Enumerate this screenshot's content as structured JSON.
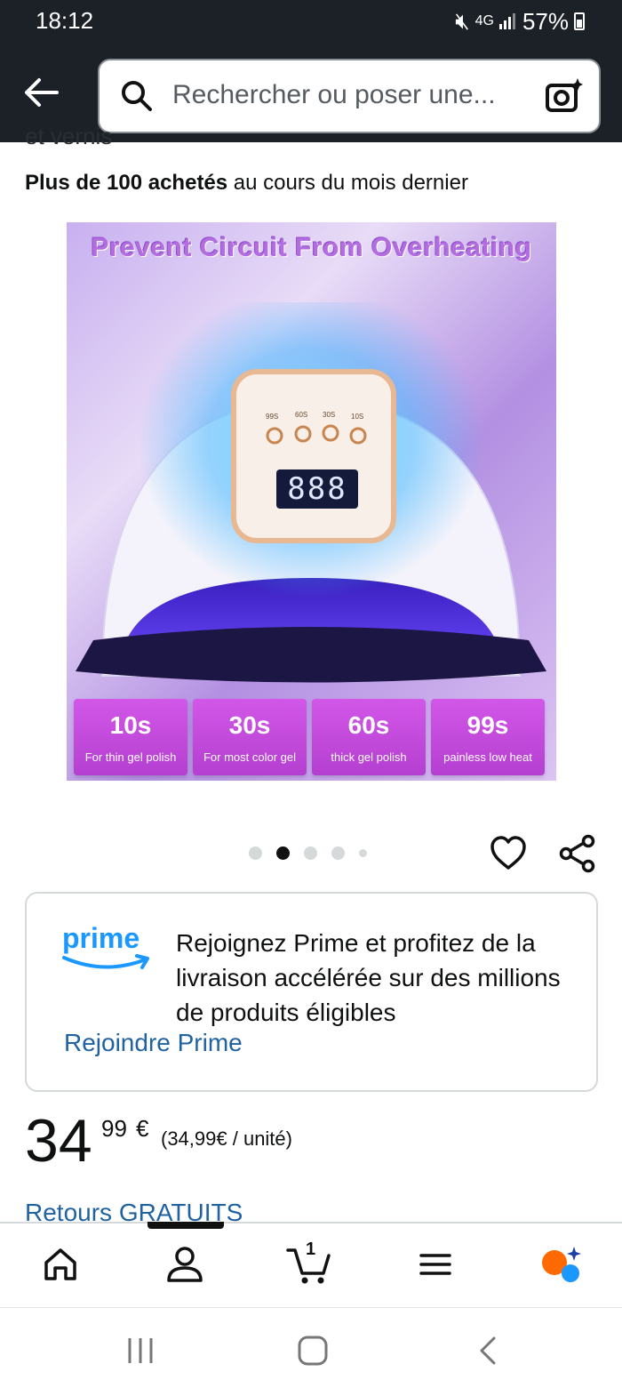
{
  "status_bar": {
    "time": "18:12",
    "network": "4G",
    "battery": "57%"
  },
  "search": {
    "placeholder": "Rechercher ou poser une..."
  },
  "cut_off_text": "et vernis",
  "purchases": {
    "bold": "Plus de 100 achetés",
    "rest": " au cours du mois dernier"
  },
  "product_image": {
    "headline": "Prevent Circuit From Overheating",
    "display": "888",
    "buttons": [
      "99S",
      "60S",
      "30S",
      "10S"
    ],
    "times": [
      {
        "value": "10s",
        "desc": "For thin gel polish"
      },
      {
        "value": "30s",
        "desc": "For most color gel"
      },
      {
        "value": "60s",
        "desc": "thick gel polish"
      },
      {
        "value": "99s",
        "desc": "painless low heat"
      }
    ]
  },
  "carousel": {
    "count": 5,
    "active_index": 1
  },
  "prime": {
    "logo": "prime",
    "text": "Rejoignez Prime et profitez de la livraison accélérée sur des millions de produits éligibles",
    "link": "Rejoindre Prime"
  },
  "price": {
    "whole": "34",
    "fraction": "99",
    "currency": "€",
    "unit_price": "(34,99€ / unité)"
  },
  "returns": "Retours GRATUITS",
  "bottom_nav": {
    "cart_count": "1",
    "icons": [
      "home-icon",
      "account-icon",
      "cart-icon",
      "menu-icon",
      "rufus-icon"
    ]
  },
  "colors": {
    "header_bg": "#1c2127",
    "link": "#2162a1",
    "prime_blue": "#1a98ff",
    "brand_orange": "#ff6a00"
  }
}
